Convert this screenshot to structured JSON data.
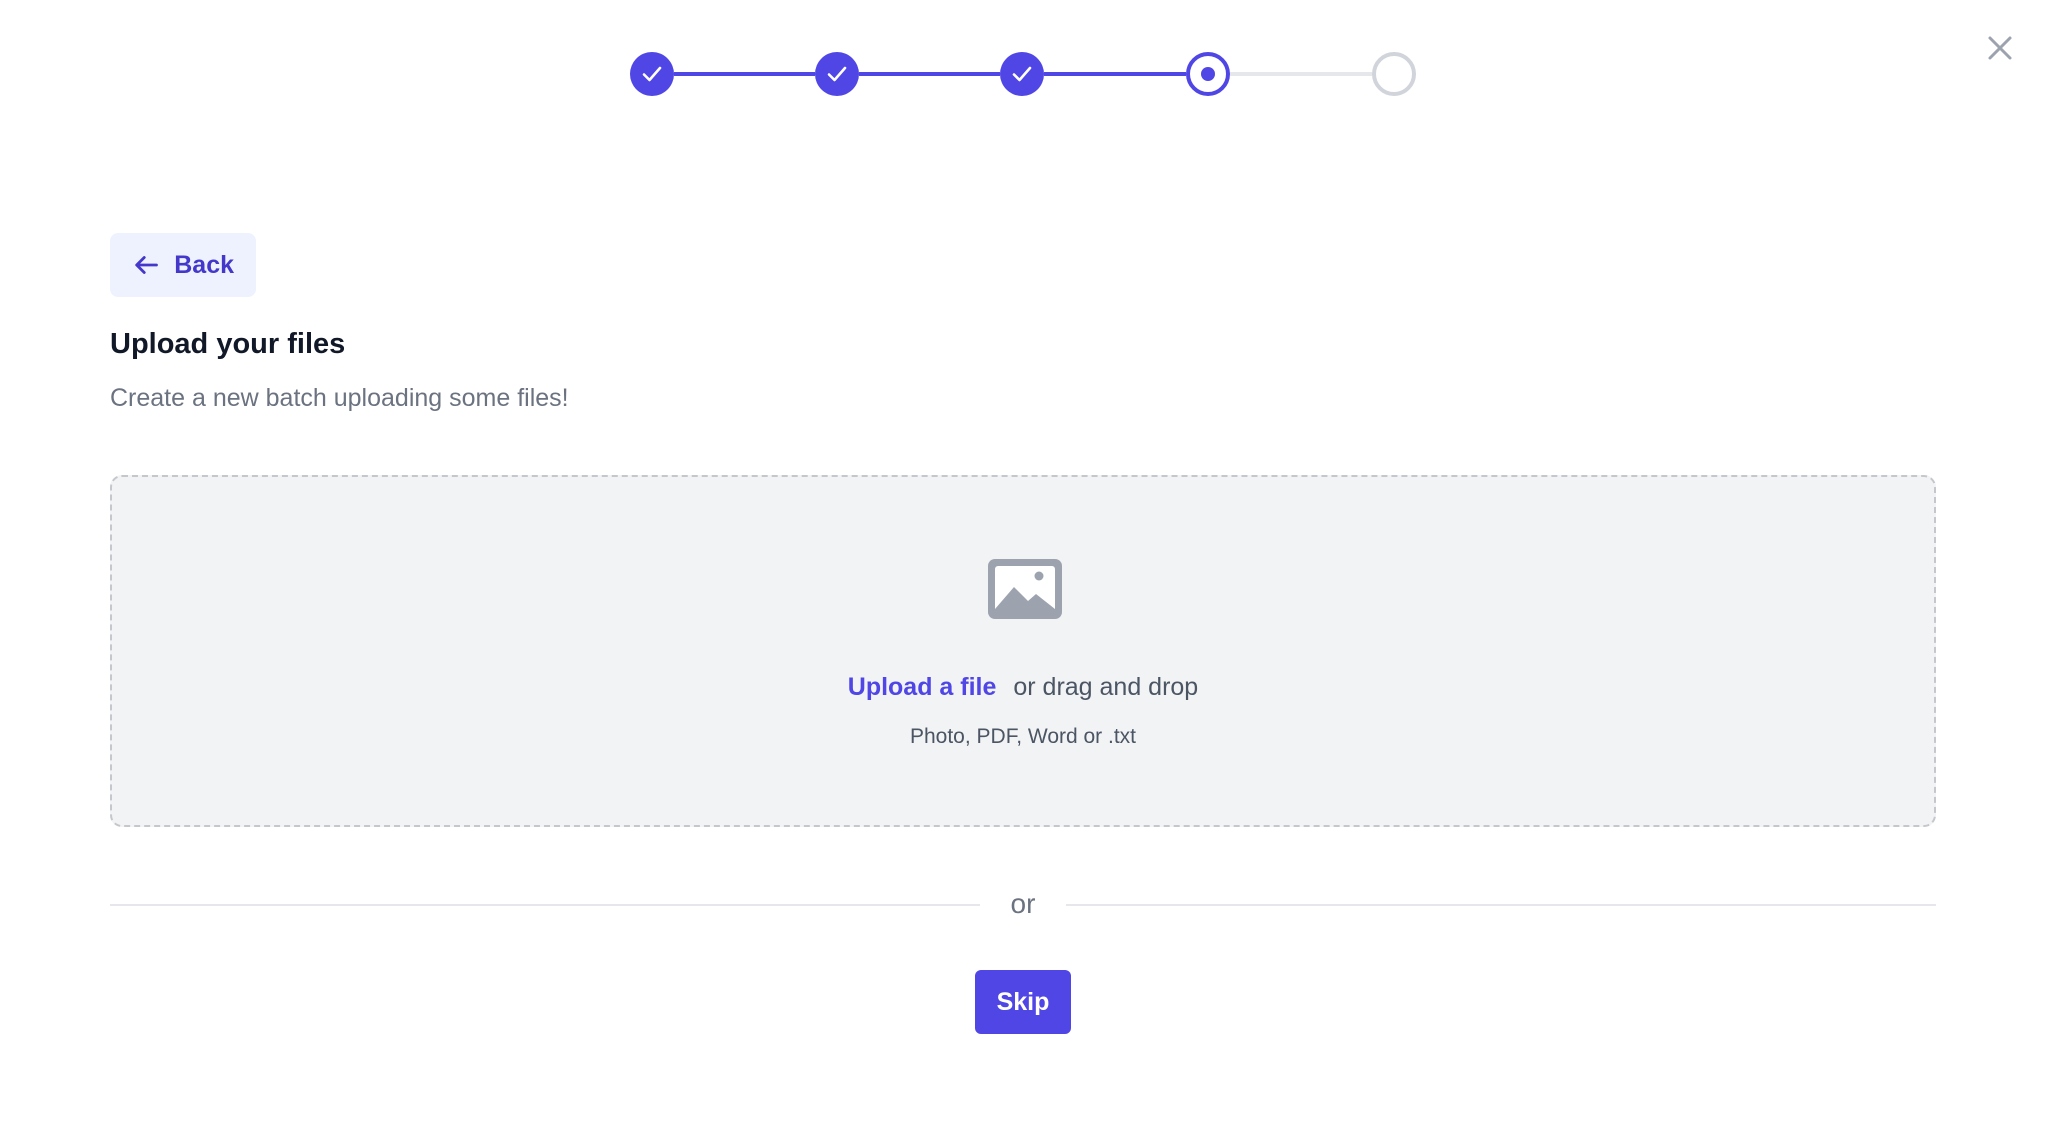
{
  "header": {
    "close_icon": "close-icon"
  },
  "stepper": {
    "steps": [
      {
        "state": "complete"
      },
      {
        "state": "complete"
      },
      {
        "state": "complete"
      },
      {
        "state": "current"
      },
      {
        "state": "upcoming"
      }
    ],
    "current_step": 4,
    "total_steps": 5
  },
  "back": {
    "label": "Back",
    "icon": "arrow-left-icon"
  },
  "content": {
    "title": "Upload your files",
    "subtitle": "Create a new batch uploading some files!"
  },
  "dropzone": {
    "icon": "image-icon",
    "link_label": "Upload a file",
    "drag_text": "or drag and drop",
    "hint": "Photo, PDF, Word or .txt"
  },
  "divider": {
    "text": "or"
  },
  "actions": {
    "skip_label": "Skip"
  },
  "colors": {
    "accent": "#4f46e5",
    "accent_light": "#eef2ff",
    "inactive": "#d1d5db",
    "dropzone_bg": "#f2f3f5"
  }
}
